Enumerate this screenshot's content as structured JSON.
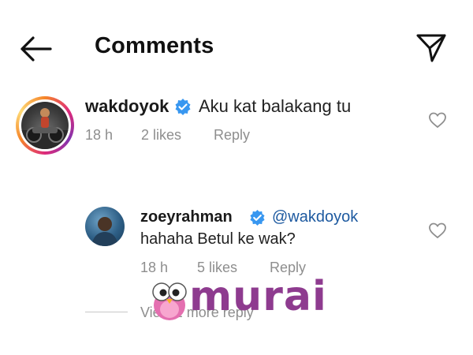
{
  "header": {
    "title": "Comments",
    "back_icon": "arrow-left-icon",
    "send_icon": "paper-plane-icon"
  },
  "comments": [
    {
      "username": "wakdoyok",
      "verified": true,
      "text": "Aku kat balakang tu",
      "time": "18 h",
      "likes": "2 likes",
      "reply": "Reply"
    },
    {
      "username": "zoeyrahman",
      "verified": true,
      "mention": "@wakdoyok",
      "text": "hahaha Betul ke wak?",
      "time": "18 h",
      "likes": "5 likes",
      "reply": "Reply",
      "view_more": "View 1 more reply"
    }
  ],
  "watermark": {
    "text": "murai"
  },
  "colors": {
    "verified_blue": "#3897f0",
    "mention_blue": "#1e5aa0",
    "meta_gray": "#8e8e8e",
    "watermark_purple": "#8e3b8f"
  }
}
